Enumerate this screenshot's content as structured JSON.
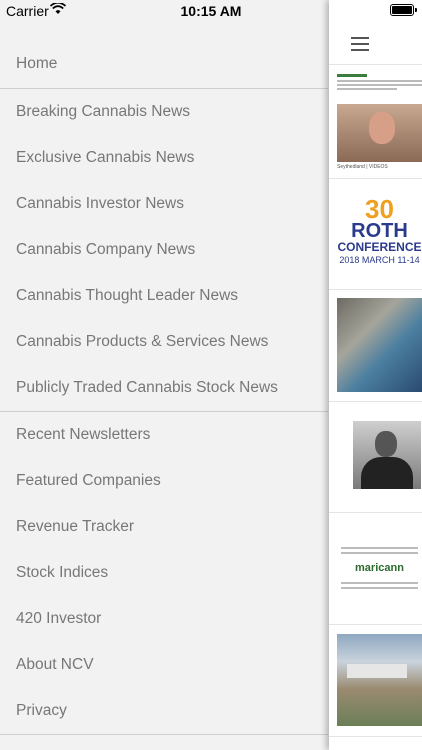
{
  "status_bar": {
    "carrier": "Carrier",
    "time": "10:15 AM"
  },
  "menu": {
    "home": "Home",
    "news": [
      "Breaking Cannabis News",
      "Exclusive Cannabis News",
      "Cannabis Investor News",
      "Cannabis Company News",
      "Cannabis Thought Leader News",
      "Cannabis Products & Services News",
      "Publicly Traded Cannabis Stock News"
    ],
    "more": [
      "Recent Newsletters",
      "Featured Companies",
      "Revenue Tracker",
      "Stock Indices",
      "420 Investor",
      "About NCV",
      "Privacy"
    ]
  },
  "panel": {
    "thumb1_caption": "Seythedland | VIDEOS",
    "roth": {
      "number": "30",
      "name": "ROTH",
      "conference": "CONFERENCE",
      "date": "2018 MARCH 11-14"
    },
    "maricann": "maricann"
  }
}
